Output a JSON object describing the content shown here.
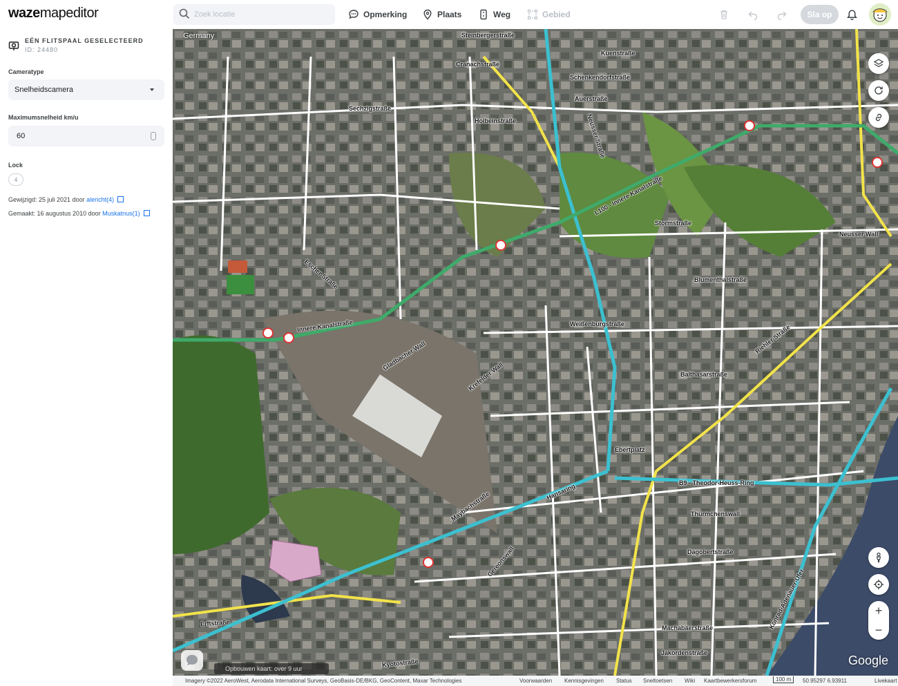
{
  "app": {
    "logo_bold": "waze",
    "logo_light": "mapeditor"
  },
  "search": {
    "placeholder": "Zoek locatie"
  },
  "toolbar": {
    "comment_label": "Opmerking",
    "place_label": "Plaats",
    "road_label": "Weg",
    "area_label": "Gebied",
    "save_label": "Sla op"
  },
  "feature": {
    "title": "EÉN FLITSPAAL GESELECTEERD",
    "id_text": "ID: 24480",
    "camera_type_label": "Cameratype",
    "camera_type_value": "Snelheidscamera",
    "max_speed_label": "Maximumsnelheid km/u",
    "max_speed_value": "60",
    "lock_label": "Lock",
    "lock_value": "4",
    "updated_prefix": "Gewijzigd: 25 juli 2021 door",
    "updated_user": "alericht(4)",
    "created_prefix": "Gemaakt: 16 augustus 2010 door",
    "created_user": "Muskatnus(1)"
  },
  "map": {
    "country": "Germany",
    "loading_text": "Opbouwen kaart: over 9 uur",
    "google": "Google",
    "street_labels": [
      "Steinbergerstraße",
      "Kuenstraße",
      "Cranachstraße",
      "Schenkendorfstraße",
      "Auerstraße",
      "Sechzigstraße",
      "Holbeinstraße",
      "L100 - Innere Kanalstraße",
      "Stormstraße",
      "Neusser Wall",
      "Escher Straße",
      "Innere Kanalstraße",
      "Gladbacher Wall",
      "Weißenburgstraße",
      "Blumenthalstraße",
      "Balthasarstraße",
      "Riehler Straße",
      "Ebertplatz",
      "B9 - Theodor-Heuss-Ring",
      "Thürmchenswall",
      "Hansaring",
      "Maybachstraße",
      "Gereonswall",
      "Erftstraße",
      "Kyotostraße",
      "Dagobertstraße",
      "Machabäerstraße",
      "Jakordenstraße",
      "Konrad-Adenauer-Ufer",
      "Krefelder Wall",
      "Neusser Straße"
    ]
  },
  "footer": {
    "imagery": "Imagery ©2022 AeroWest, Aerodata International Surveys, GeoBasis-DE/BKG, GeoContent, Maxar Technologies",
    "terms": "Voorwaarden",
    "notices": "Kennisgevingen",
    "status": "Status",
    "shortcuts": "Sneltoetsen",
    "wiki": "Wiki",
    "forum": "Kaartbewerkersforum",
    "scale": "100 m",
    "coords": "50.95297 6.93911",
    "livemap": "Livekaart"
  }
}
